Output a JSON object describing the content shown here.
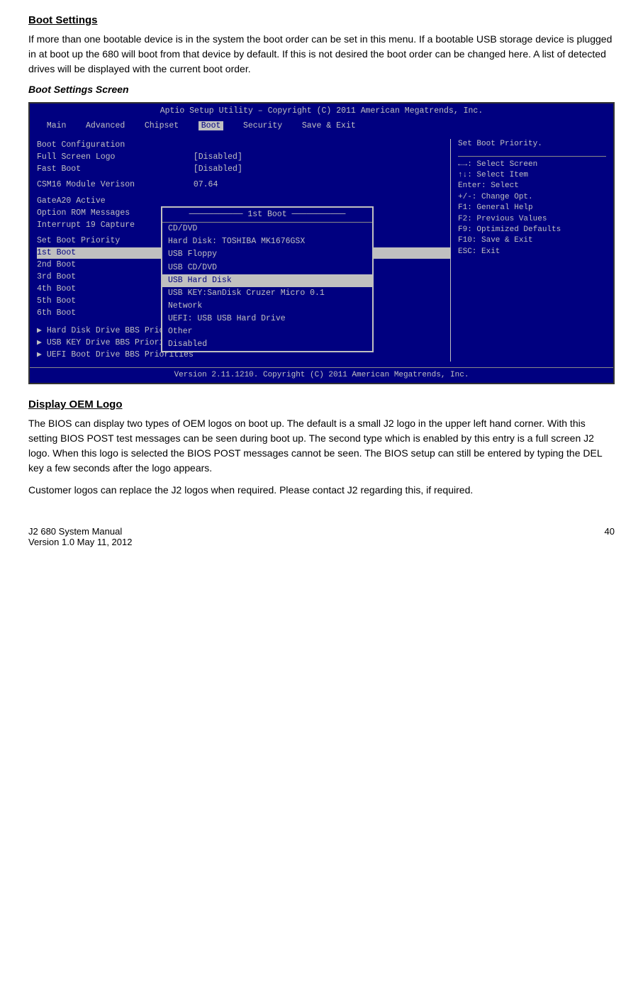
{
  "sections": {
    "boot_settings": {
      "title": "Boot Settings",
      "body_text_1": "If more than one bootable device is in the system the boot order can be set in this menu. If a bootable USB storage device is plugged in at boot up the 680 will boot from that device by default. If this is not desired the boot order can be changed here. A list of detected drives will be displayed with the current boot order.",
      "subtitle": "Boot Settings Screen"
    },
    "display_oem": {
      "title": "Display OEM Logo",
      "body_text_1": "The BIOS can display two types of OEM logos on boot up. The default is a small J2 logo in the upper left hand corner. With this setting BIOS POST test messages can be seen during boot up. The second type which is enabled by this entry is a full screen J2 logo. When this logo is selected the BIOS POST messages cannot be seen. The BIOS setup can still be entered by typing the DEL key a few seconds after the logo appears.",
      "body_text_2": "Customer logos can replace the J2 logos when required. Please contact J2 regarding this, if required."
    }
  },
  "bios": {
    "header": "Aptio Setup Utility – Copyright (C) 2011 American Megatrends, Inc.",
    "nav_items": [
      "Main",
      "Advanced",
      "Chipset",
      "Boot",
      "Security",
      "Save & Exit"
    ],
    "nav_active": "Boot",
    "left_panel": {
      "items": [
        {
          "label": "Boot Configuration",
          "value": "",
          "type": "section"
        },
        {
          "label": "Full Screen Logo",
          "value": "[Disabled]",
          "type": "item"
        },
        {
          "label": "Fast Boot",
          "value": "[Disabled]",
          "type": "item"
        },
        {
          "label": "",
          "value": "",
          "type": "spacer"
        },
        {
          "label": "CSM16 Module Verison",
          "value": "07.64",
          "type": "item"
        },
        {
          "label": "",
          "value": "",
          "type": "spacer"
        },
        {
          "label": "GateA20 Active",
          "value": "",
          "type": "item"
        },
        {
          "label": "Option ROM Messages",
          "value": "",
          "type": "item"
        },
        {
          "label": "Interrupt 19 Capture",
          "value": "",
          "type": "item"
        },
        {
          "label": "",
          "value": "",
          "type": "spacer"
        },
        {
          "label": "Set Boot Priority",
          "value": "",
          "type": "item"
        },
        {
          "label": "1st Boot",
          "value": "",
          "type": "item_highlight"
        },
        {
          "label": "2nd Boot",
          "value": "",
          "type": "item"
        },
        {
          "label": "3rd Boot",
          "value": "",
          "type": "item"
        },
        {
          "label": "4th Boot",
          "value": "",
          "type": "item"
        },
        {
          "label": "5th Boot",
          "value": "",
          "type": "item"
        },
        {
          "label": "6th Boot",
          "value": "",
          "type": "item"
        },
        {
          "label": "",
          "value": "",
          "type": "spacer"
        },
        {
          "label": "▶ Hard Disk Drive BBS Priorities",
          "value": "",
          "type": "item"
        },
        {
          "label": "▶ USB KEY Drive BBS Priorities",
          "value": "",
          "type": "item"
        },
        {
          "label": "▶ UEFI Boot Drive BBS Priorities",
          "value": "",
          "type": "item"
        }
      ]
    },
    "right_panel": {
      "help_text": "Set Boot Priority.",
      "keys": [
        "←→: Select Screen",
        "↑↓: Select Item",
        "Enter: Select",
        "+/-: Change Opt.",
        "F1: General Help",
        "F2: Previous Values",
        "F9: Optimized Defaults",
        "F10: Save & Exit",
        "ESC: Exit"
      ]
    },
    "dropdown": {
      "title": "1st Boot",
      "items": [
        {
          "label": "CD/DVD",
          "selected": false
        },
        {
          "label": "Hard Disk: TOSHIBA MK1676GSX",
          "selected": false
        },
        {
          "label": "USB Floppy",
          "selected": false
        },
        {
          "label": "USB CD/DVD",
          "selected": false
        },
        {
          "label": "USB Hard Disk",
          "selected": true
        },
        {
          "label": "USB KEY:SanDisk Cruzer Micro 0.1",
          "selected": false
        },
        {
          "label": "Network",
          "selected": false
        },
        {
          "label": "UEFI: USB USB Hard Drive",
          "selected": false
        },
        {
          "label": "Other",
          "selected": false
        },
        {
          "label": "Disabled",
          "selected": false
        }
      ]
    },
    "footer": "Version 2.11.1210. Copyright (C) 2011 American Megatrends, Inc."
  },
  "page_footer": {
    "left": "J2 680 System Manual",
    "right": "40",
    "version": "Version 1.0 May 11, 2012"
  }
}
